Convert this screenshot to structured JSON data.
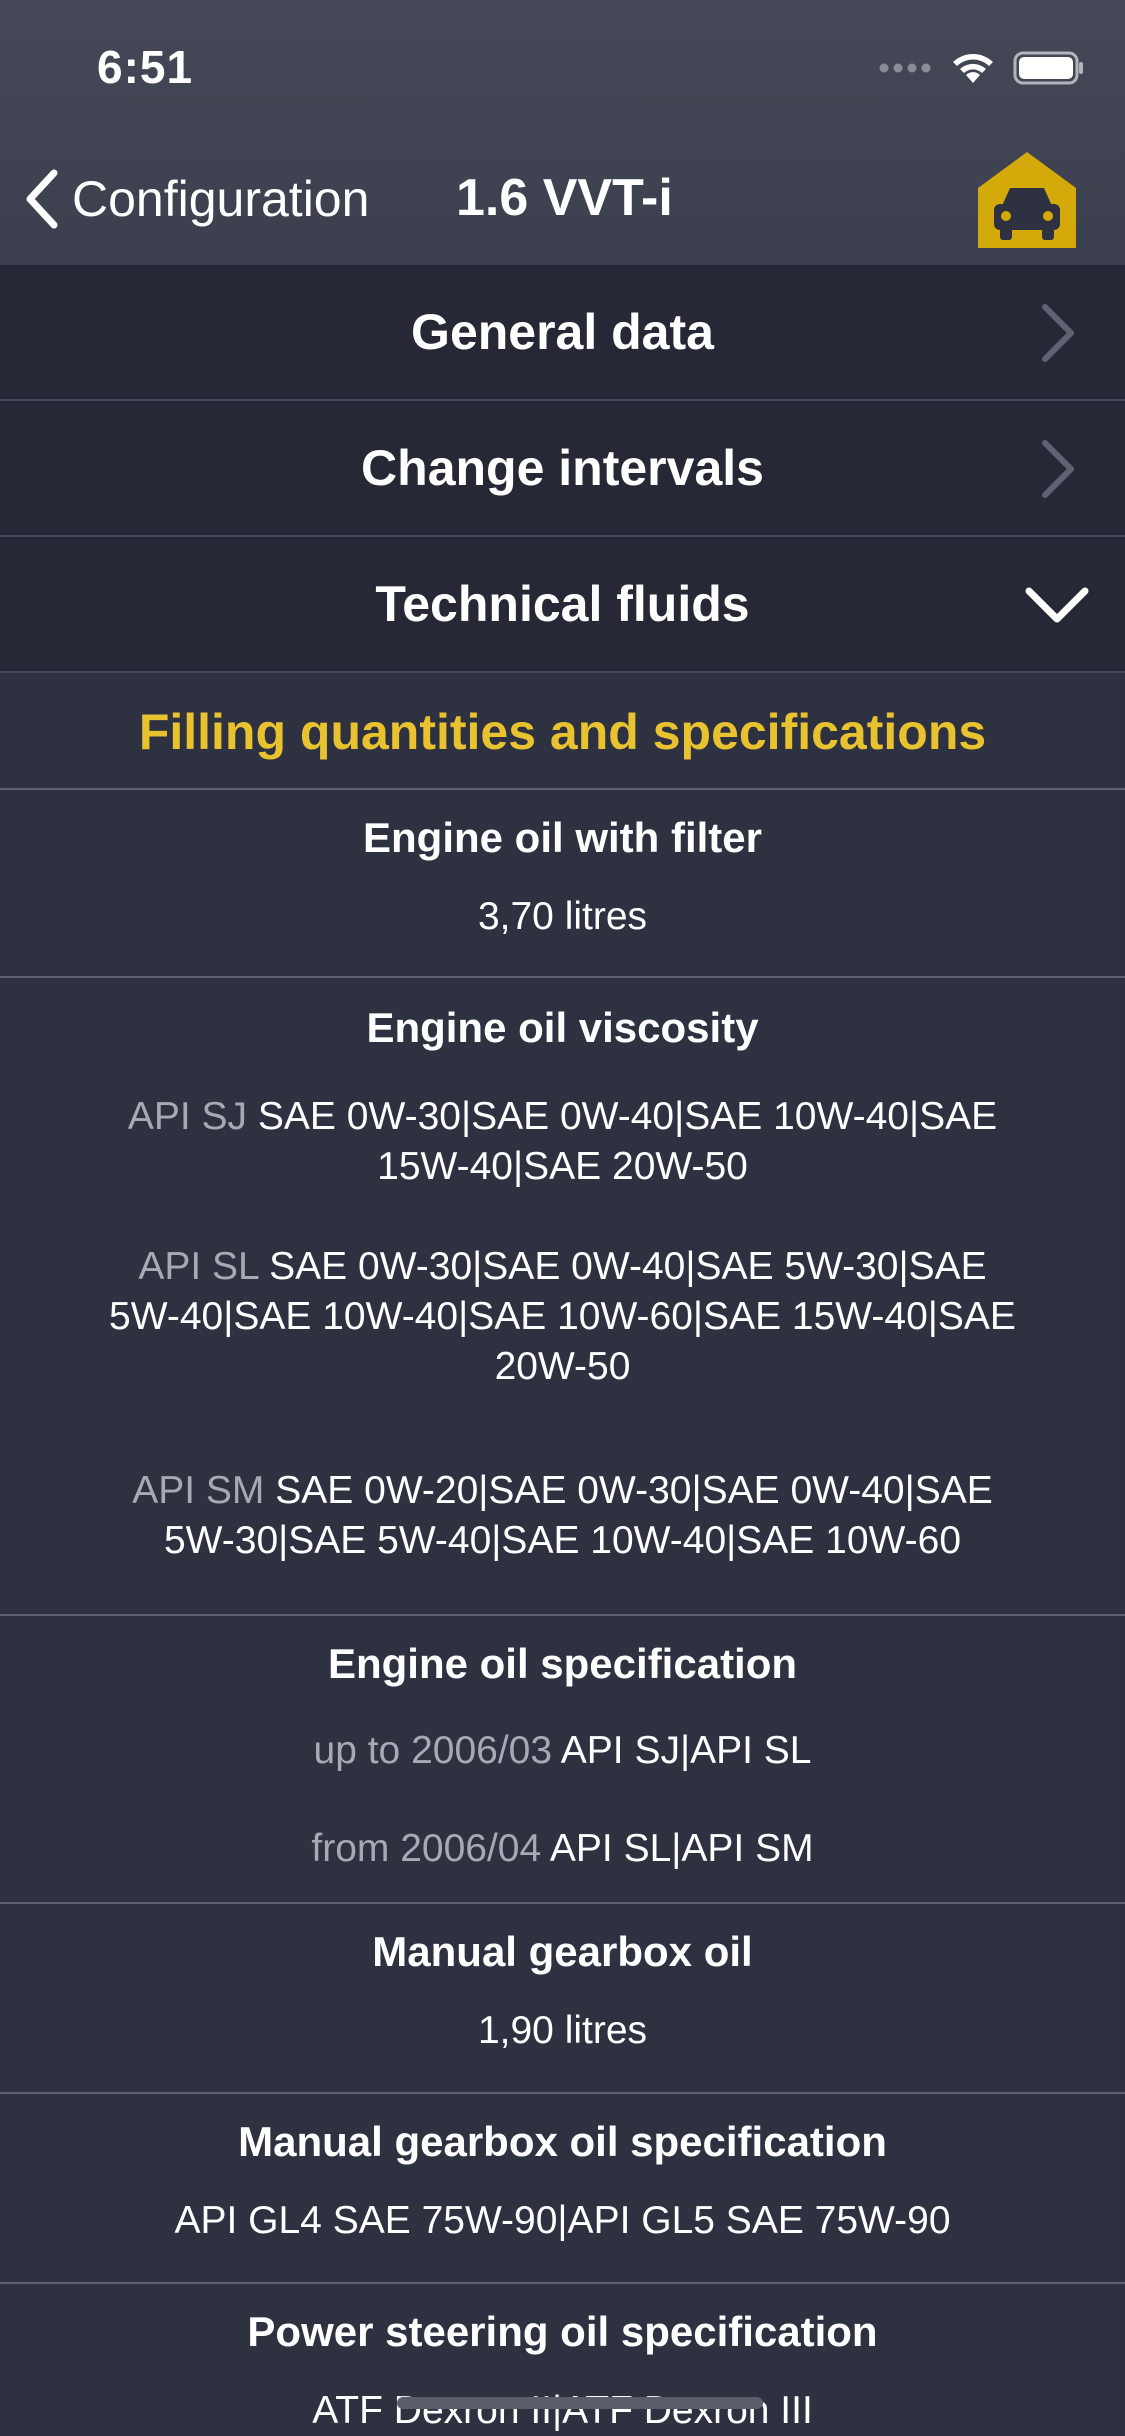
{
  "status_bar": {
    "time": "6:51"
  },
  "nav": {
    "back_label": "Configuration",
    "title": "1.6 VVT-i"
  },
  "sections": [
    {
      "label": "General data",
      "state": "collapsed"
    },
    {
      "label": "Change intervals",
      "state": "collapsed"
    },
    {
      "label": "Technical fluids",
      "state": "expanded"
    }
  ],
  "content": {
    "subheader": "Filling quantities and specifications",
    "engine_oil_filter": {
      "title": "Engine oil with filter",
      "value": "3,70 litres"
    },
    "engine_oil_viscosity": {
      "title": "Engine oil viscosity",
      "entries": [
        {
          "prefix": "API SJ",
          "line1": "SAE 0W-30|SAE 0W-40|SAE 10W-40|SAE",
          "line2": "15W-40|SAE 20W-50"
        },
        {
          "prefix": "API SL",
          "line1": "SAE 0W-30|SAE 0W-40|SAE 5W-30|SAE",
          "line2": "5W-40|SAE 10W-40|SAE 10W-60|SAE 15W-40|SAE",
          "line3": "20W-50"
        },
        {
          "prefix": "API SM",
          "line1": "SAE 0W-20|SAE 0W-30|SAE 0W-40|SAE",
          "line2": "5W-30|SAE 5W-40|SAE 10W-40|SAE 10W-60"
        }
      ]
    },
    "engine_oil_spec": {
      "title": "Engine oil specification",
      "entries": [
        {
          "prefix": "up to 2006/03",
          "value": "API SJ|API SL"
        },
        {
          "prefix": "from 2006/04",
          "value": "API SL|API SM"
        }
      ]
    },
    "manual_gearbox_oil": {
      "title": "Manual gearbox oil",
      "value": "1,90 litres"
    },
    "manual_gearbox_spec": {
      "title": "Manual gearbox oil specification",
      "value": "API GL4 SAE 75W-90|API GL5 SAE 75W-90"
    },
    "power_steering_spec": {
      "title": "Power steering oil specification",
      "value": "ATF Dexron II|ATF Dexron III"
    }
  },
  "colors": {
    "accent_yellow": "#e9c230",
    "garage_icon_bg": "#d4a90a",
    "background": "#2e3140",
    "section_bg": "#262935",
    "muted_text": "#a7a9b3"
  },
  "icons": {
    "back": "chevron-left-icon",
    "garage": "garage-car-icon",
    "collapsed": "chevron-right-icon",
    "expanded": "chevron-down-icon",
    "signal": "cellular-signal-icon",
    "wifi": "wifi-icon",
    "battery": "battery-icon"
  }
}
